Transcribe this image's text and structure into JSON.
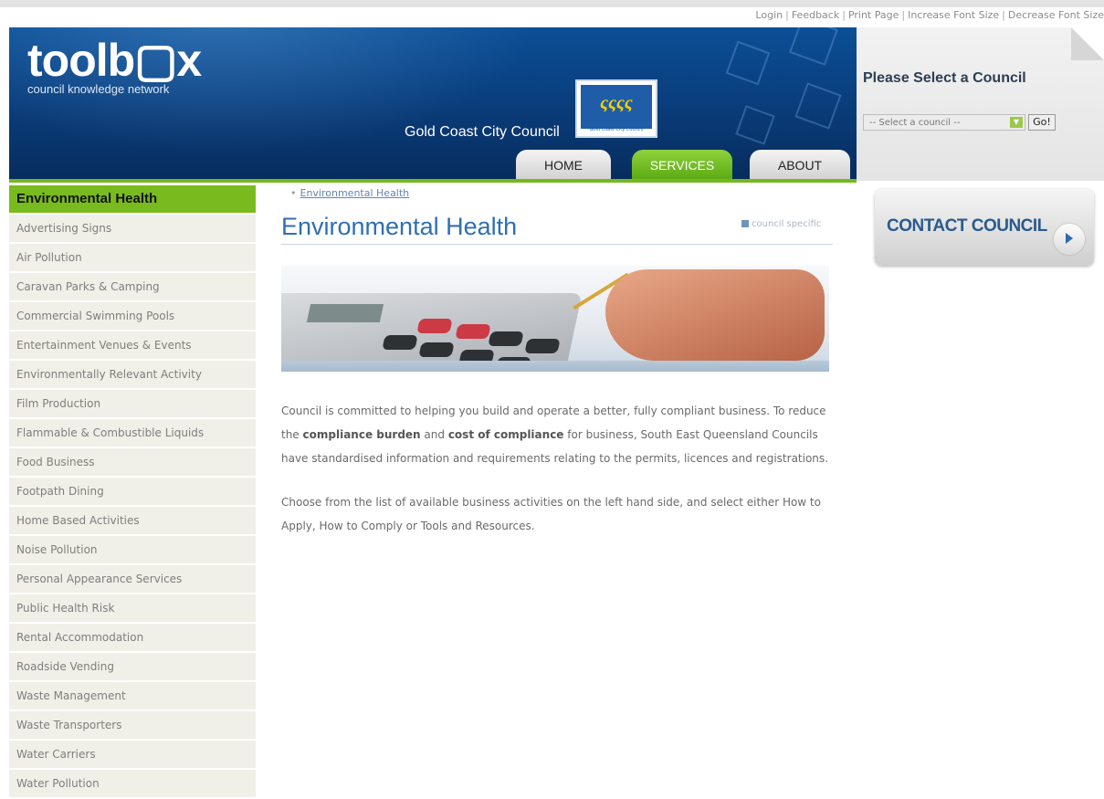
{
  "utility_links": [
    "Login",
    "Feedback",
    "Print Page",
    "Increase Font Size",
    "Decrease Font Size"
  ],
  "brand": {
    "name": "toolb▢x",
    "tagline": "council knowledge network"
  },
  "header": {
    "council_name": "Gold Coast City Council",
    "council_logo_text": "ςςςς",
    "council_logo_small": "Gold Coast City Council"
  },
  "nav_tabs": [
    {
      "label": "HOME",
      "active": false
    },
    {
      "label": "SERVICES",
      "active": true
    },
    {
      "label": "ABOUT",
      "active": false
    }
  ],
  "council_panel": {
    "title": "Please Select a Council",
    "select_value": "-- Select a council --",
    "go_label": "Go!"
  },
  "sidebar": {
    "heading": "Environmental Health",
    "items": [
      "Advertising Signs",
      "Air Pollution",
      "Caravan Parks & Camping",
      "Commercial Swimming Pools",
      "Entertainment Venues & Events",
      "Environmentally Relevant Activity",
      "Film Production",
      "Flammable & Combustible Liquids",
      "Food Business",
      "Footpath Dining",
      "Home Based Activities",
      "Noise Pollution",
      "Personal Appearance Services",
      "Public Health Risk",
      "Rental Accommodation",
      "Roadside Vending",
      "Waste Management",
      "Waste Transporters",
      "Water Carriers",
      "Water Pollution"
    ]
  },
  "main": {
    "breadcrumb": "Environmental Health",
    "title": "Environmental Health",
    "council_specific": "council specific",
    "para1_a": "Council is committed to helping you build and operate a better, fully compliant business. To reduce the ",
    "para1_b1": "compliance burden",
    "para1_c": " and ",
    "para1_b2": "cost of compliance",
    "para1_d": " for business, South East Queensland Councils have standardised information and requirements relating to the permits, licences and registrations.",
    "para2": "Choose from the list of available business activities on the left hand side, and select either How to Apply, How to Comply or Tools and Resources."
  },
  "contact": {
    "label": "CONTACT COUNCIL"
  },
  "colors": {
    "header_blue": "#0a3f7e",
    "accent_green": "#79bb1f",
    "title_blue": "#2f6fb2"
  }
}
